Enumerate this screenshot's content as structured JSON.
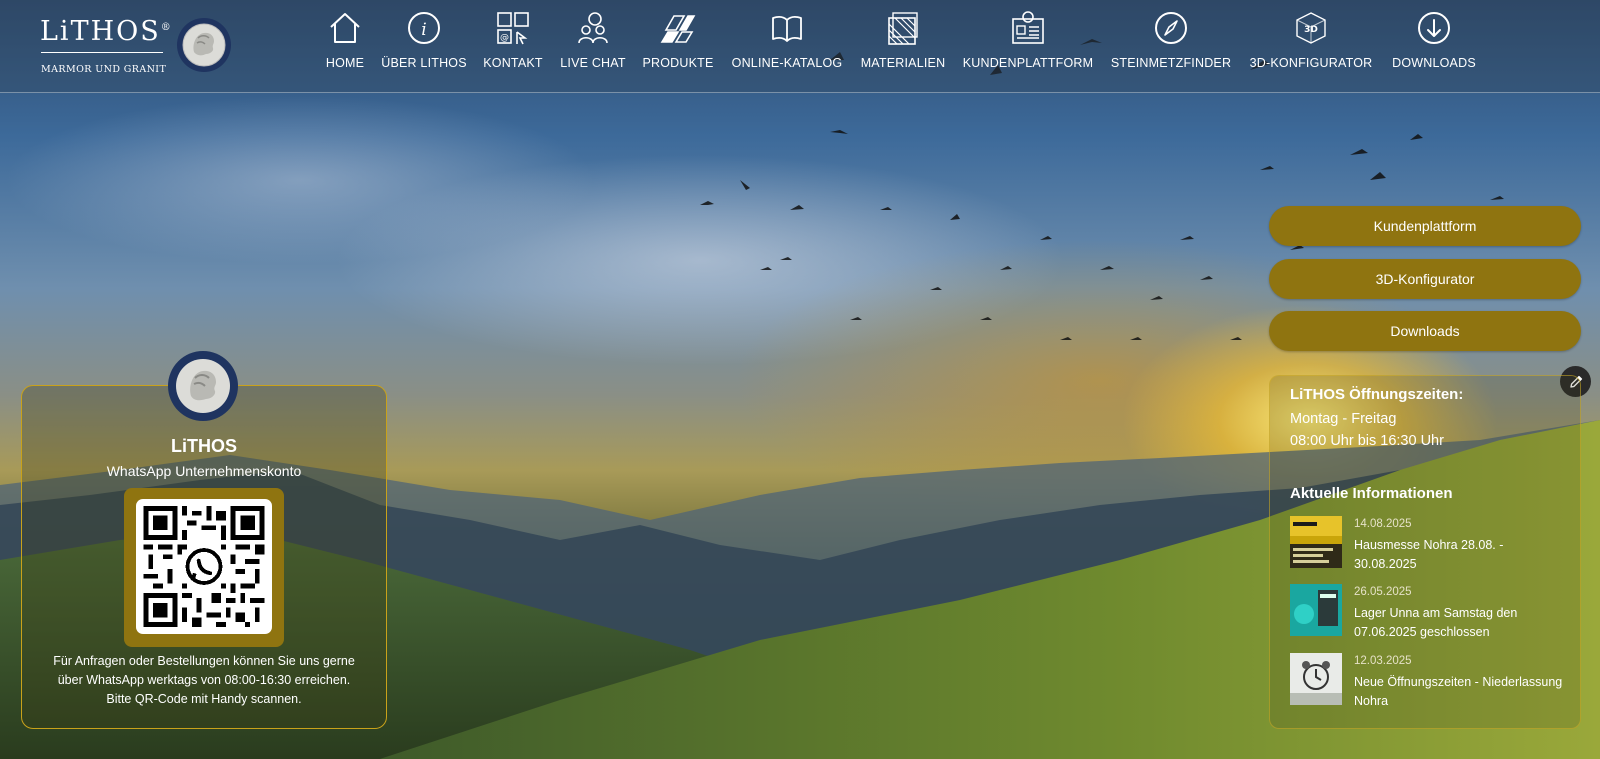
{
  "brand": {
    "name": "LiTHOS",
    "registered": "®",
    "tagline": "MARMOR UND GRANIT"
  },
  "nav": [
    {
      "label": "HOME",
      "icon": "home-icon"
    },
    {
      "label": "ÜBER LITHOS",
      "icon": "info-icon"
    },
    {
      "label": "KONTAKT",
      "icon": "contact-icon"
    },
    {
      "label": "LIVE CHAT",
      "icon": "live-chat-icon"
    },
    {
      "label": "PRODUKTE",
      "icon": "products-icon"
    },
    {
      "label": "ONLINE-KATALOG",
      "icon": "book-icon"
    },
    {
      "label": "MATERIALIEN",
      "icon": "materials-icon"
    },
    {
      "label": "KUNDENPLATTFORM",
      "icon": "customer-platform-icon"
    },
    {
      "label": "STEINMETZFINDER",
      "icon": "compass-icon"
    },
    {
      "label": "3D-KONFIGURATOR",
      "icon": "cube-3d-icon"
    },
    {
      "label": "DOWNLOADS",
      "icon": "download-icon"
    }
  ],
  "actions": {
    "platform": "Kundenplattform",
    "configurator": "3D-Konfigurator",
    "downloads": "Downloads"
  },
  "hours": {
    "title": "LiTHOS Öffnungszeiten:",
    "days": "Montag - Freitag",
    "time": "08:00 Uhr bis 16:30 Uhr"
  },
  "news": {
    "title": "Aktuelle Informationen",
    "items": [
      {
        "date": "14.08.2025",
        "title": "Hausmesse Nohra 28.08. - 30.08.2025"
      },
      {
        "date": "26.05.2025",
        "title": "Lager Unna am Samstag den 07.06.2025 geschlossen"
      },
      {
        "date": "12.03.2025",
        "title": "Neue Öffnungszeiten - Niederlassung Nohra"
      }
    ]
  },
  "whatsapp": {
    "name": "LiTHOS",
    "subtitle": "WhatsApp Unternehmenskonto",
    "line1": "Für Anfragen oder Bestellungen können Sie uns gerne",
    "line2": "über WhatsApp werktags von 08:00-16:30 erreichen.",
    "line3": "Bitte QR-Code mit Handy scannen."
  },
  "colors": {
    "accent": "#8f7410",
    "border_gold": "#c9a21a"
  }
}
